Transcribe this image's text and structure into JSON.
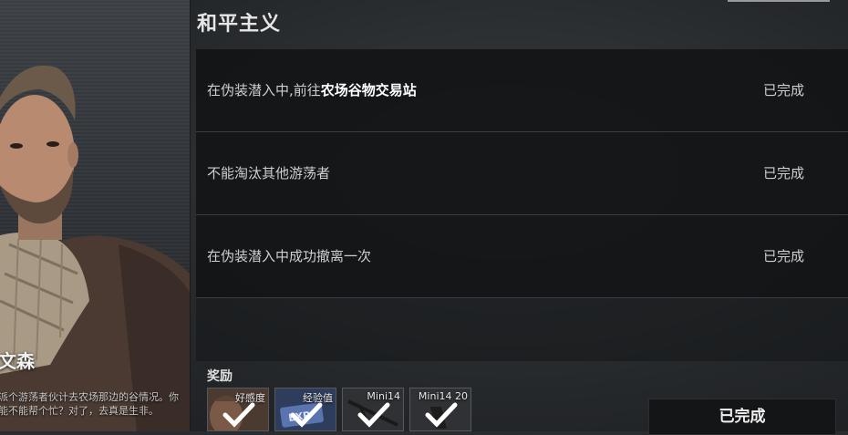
{
  "mission": {
    "title": "和平主义"
  },
  "npc": {
    "name": "文森",
    "description": "派个游荡者伙计去农场那边的谷情况。你能不能帮个忙？对了，去真是生非。"
  },
  "tasks": [
    {
      "prefix": "在伪装潜入中,前往",
      "highlight": "农场谷物交易站",
      "status": "已完成"
    },
    {
      "prefix": "不能淘汰其他游荡者",
      "highlight": "",
      "status": "已完成"
    },
    {
      "prefix": "在伪装潜入中成功撤离一次",
      "highlight": "",
      "status": "已完成"
    }
  ],
  "rewards": {
    "label": "奖励",
    "items": [
      {
        "name": "好感度",
        "icon": "favor-icon",
        "bg": "#4a3a30"
      },
      {
        "name": "经验值",
        "icon": "exp-card-icon",
        "bg": "#2e3d5c"
      },
      {
        "name": "Mini14",
        "icon": "rifle-icon",
        "bg": "#2f3134"
      },
      {
        "name": "Mini14 20",
        "icon": "magazine-icon",
        "bg": "#2f3134"
      }
    ]
  },
  "footer": {
    "complete_label": "已完成"
  }
}
